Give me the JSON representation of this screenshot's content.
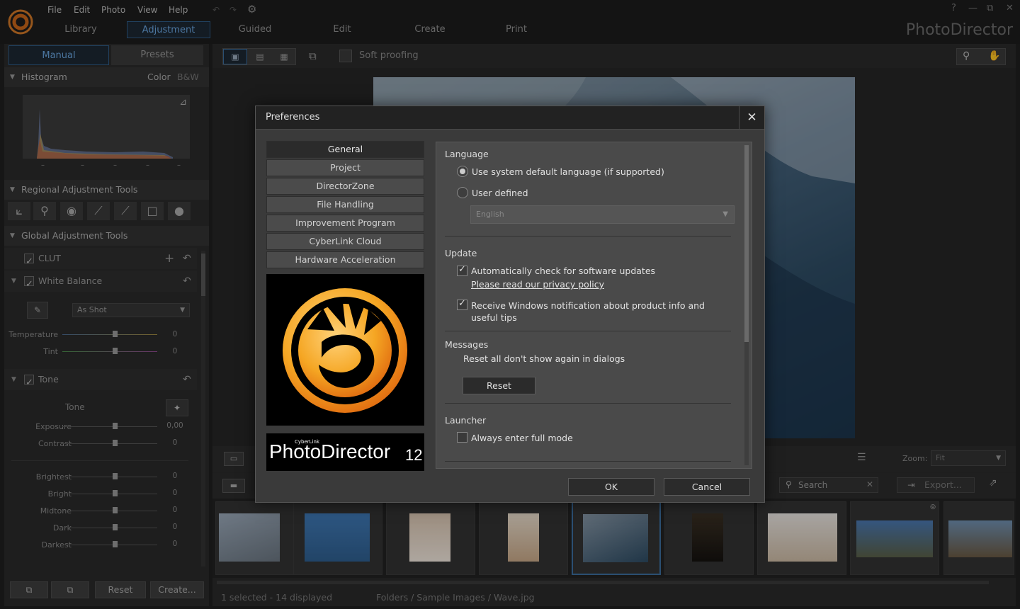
{
  "menu": {
    "file": "File",
    "edit": "Edit",
    "photo": "Photo",
    "view": "View",
    "help": "Help"
  },
  "modules": [
    "Library",
    "Adjustment",
    "Guided",
    "Edit",
    "Create",
    "Print"
  ],
  "active_module": "Adjustment",
  "app_name": "PhotoDirector",
  "window_controls": {
    "help": "?",
    "minimize": "—",
    "restore": "⧉",
    "close": "✕"
  },
  "left_panel": {
    "tabs": {
      "manual": "Manual",
      "presets": "Presets"
    },
    "histogram": {
      "title": "Histogram",
      "color": "Color",
      "bw": "B&W",
      "ticks": [
        "–",
        "–",
        "–",
        "–",
        "–"
      ]
    },
    "regional_title": "Regional Adjustment Tools",
    "global_title": "Global Adjustment Tools",
    "clut": "CLUT",
    "white_balance": {
      "title": "White Balance",
      "preset": "As Shot",
      "sliders": [
        {
          "label": "Temperature",
          "value": "0"
        },
        {
          "label": "Tint",
          "value": "0"
        }
      ]
    },
    "tone": {
      "title": "Tone",
      "label": "Tone",
      "sliders": [
        {
          "label": "Exposure",
          "value": "0,00"
        },
        {
          "label": "Contrast",
          "value": "0"
        }
      ],
      "sliders2": [
        {
          "label": "Brightest",
          "value": "0"
        },
        {
          "label": "Bright",
          "value": "0"
        },
        {
          "label": "Midtone",
          "value": "0"
        },
        {
          "label": "Dark",
          "value": "0"
        },
        {
          "label": "Darkest",
          "value": "0"
        }
      ]
    },
    "bottom": {
      "reset": "Reset",
      "create": "Create..."
    }
  },
  "toolbar": {
    "soft_proofing": "Soft proofing"
  },
  "view_bar": {
    "zoom_label": "Zoom:",
    "zoom_value": "Fit"
  },
  "filmstrip_bar": {
    "search_placeholder": "Search",
    "export": "Export..."
  },
  "status": {
    "selection": "1 selected - 14 displayed",
    "path": "Folders / Sample Images / Wave.jpg"
  },
  "dialog": {
    "title": "Preferences",
    "close": "✕",
    "nav": [
      "General",
      "Project",
      "DirectorZone",
      "File Handling",
      "Improvement Program",
      "CyberLink Cloud",
      "Hardware Acceleration"
    ],
    "active_nav": "General",
    "brand": {
      "small": "CyberLink",
      "name": "PhotoDirector",
      "version": "12"
    },
    "language": {
      "title": "Language",
      "option_system": "Use system default language (if supported)",
      "option_user": "User defined",
      "selected_language": "English"
    },
    "update": {
      "title": "Update",
      "auto_check": "Automatically check for software updates",
      "privacy_link": "Please read our privacy policy",
      "windows_notify": "Receive Windows notification about product info and useful tips"
    },
    "messages": {
      "title": "Messages",
      "reset_text": "Reset all don't show again in dialogs",
      "reset_button": "Reset"
    },
    "launcher": {
      "title": "Launcher",
      "full_mode": "Always enter full mode"
    },
    "buttons": {
      "ok": "OK",
      "cancel": "Cancel"
    }
  },
  "colors": {
    "accent": "#3c6e9e",
    "logo_orange": "#f5a623",
    "logo_dark": "#e06a10"
  }
}
